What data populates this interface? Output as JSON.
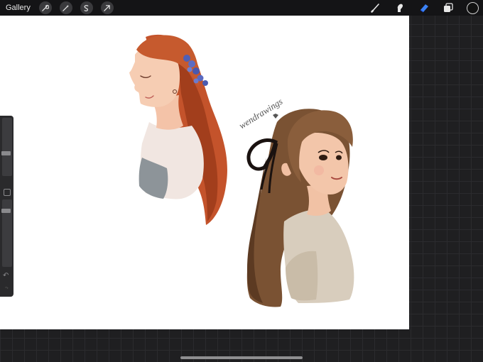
{
  "topbar": {
    "gallery_label": "Gallery",
    "left_tools": [
      "wrench-icon",
      "magic-wand-icon",
      "selection-icon",
      "transform-arrow-icon"
    ],
    "right_tools": [
      "brush-icon",
      "smudge-icon",
      "eraser-icon",
      "layers-icon"
    ],
    "active_tool": "eraser-icon",
    "active_color": "#111111",
    "accent": "#3b82f6"
  },
  "canvas": {
    "signature": "wendrawings"
  },
  "sidebar": {
    "brush_size_level": 0.38,
    "opacity_level": 0.85,
    "undo_glyph": "↶",
    "redo_glyph": "↷"
  }
}
